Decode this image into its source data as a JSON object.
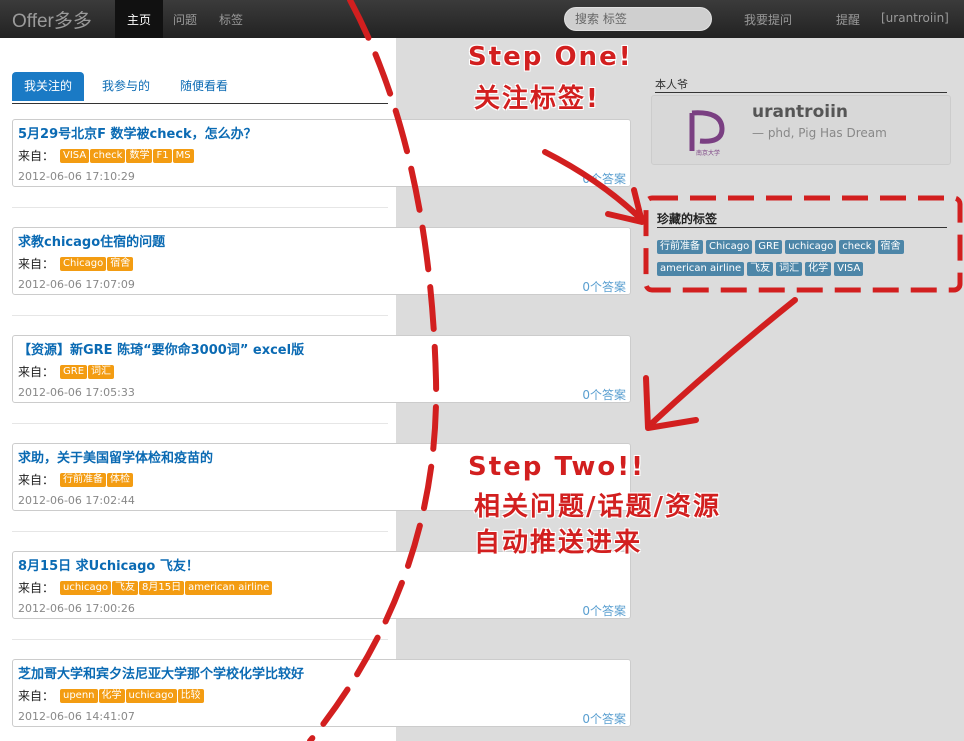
{
  "nav": {
    "brand": "Offer多多",
    "home": "主页",
    "questions": "问题",
    "tags": "标签",
    "search_placeholder": "搜索 标签",
    "ask": "我要提问",
    "remind": "提醒",
    "user": "[urantroiin]"
  },
  "tabs": [
    "我关注的",
    "我参与的",
    "随便看看"
  ],
  "from_label": "来自：",
  "questions": [
    {
      "title": "5月29号北京F 数学被check，怎么办？",
      "tags": [
        "VISA",
        "check",
        "数学",
        "F1",
        "MS"
      ],
      "time": "2012-06-06 17:10:29",
      "answers": "0个答案"
    },
    {
      "title": "求教chicago住宿的问题",
      "tags": [
        "Chicago",
        "宿舍"
      ],
      "time": "2012-06-06 17:07:09",
      "answers": "0个答案"
    },
    {
      "title": "【资源】新GRE 陈琦“要你命3000词” excel版",
      "tags": [
        "GRE",
        "词汇"
      ],
      "time": "2012-06-06 17:05:33",
      "answers": "0个答案"
    },
    {
      "title": "求助，关于美国留学体检和疫苗的",
      "tags": [
        "行前准备",
        "体检"
      ],
      "time": "2012-06-06 17:02:44",
      "answers": ""
    },
    {
      "title": "8月15日 求Uchicago 飞友！",
      "tags": [
        "uchicago",
        "飞友",
        "8月15日",
        "american airline"
      ],
      "time": "2012-06-06 17:00:26",
      "answers": "0个答案"
    },
    {
      "title": "芝加哥大学和宾夕法尼亚大学那个学校化学比较好",
      "tags": [
        "upenn",
        "化学",
        "uchicago",
        "比较"
      ],
      "time": "2012-06-06 14:41:07",
      "answers": "0个答案"
    }
  ],
  "profile": {
    "heading": "本人爷",
    "name": "urantroiin",
    "subtitle": "— phd, Pig Has Dream",
    "logo_caption": "南京大学"
  },
  "favorites": {
    "heading": "珍藏的标签",
    "tags": [
      "行前准备",
      "Chicago",
      "GRE",
      "uchicago",
      "check",
      "宿舍",
      "american airline",
      "飞友",
      "词汇",
      "化学",
      "VISA"
    ]
  },
  "annotations": {
    "step_one": "Step One!",
    "step_one_sub": "关注标签!",
    "step_two": "Step Two!!",
    "step_two_line1": "相关问题/话题/资源",
    "step_two_line2": "自动推送进来"
  },
  "colors": {
    "accent": "#1a7ac5",
    "tag_orange": "#f39c12",
    "tag_blue": "#4d86a8",
    "annotation_red": "#d21f1f"
  }
}
